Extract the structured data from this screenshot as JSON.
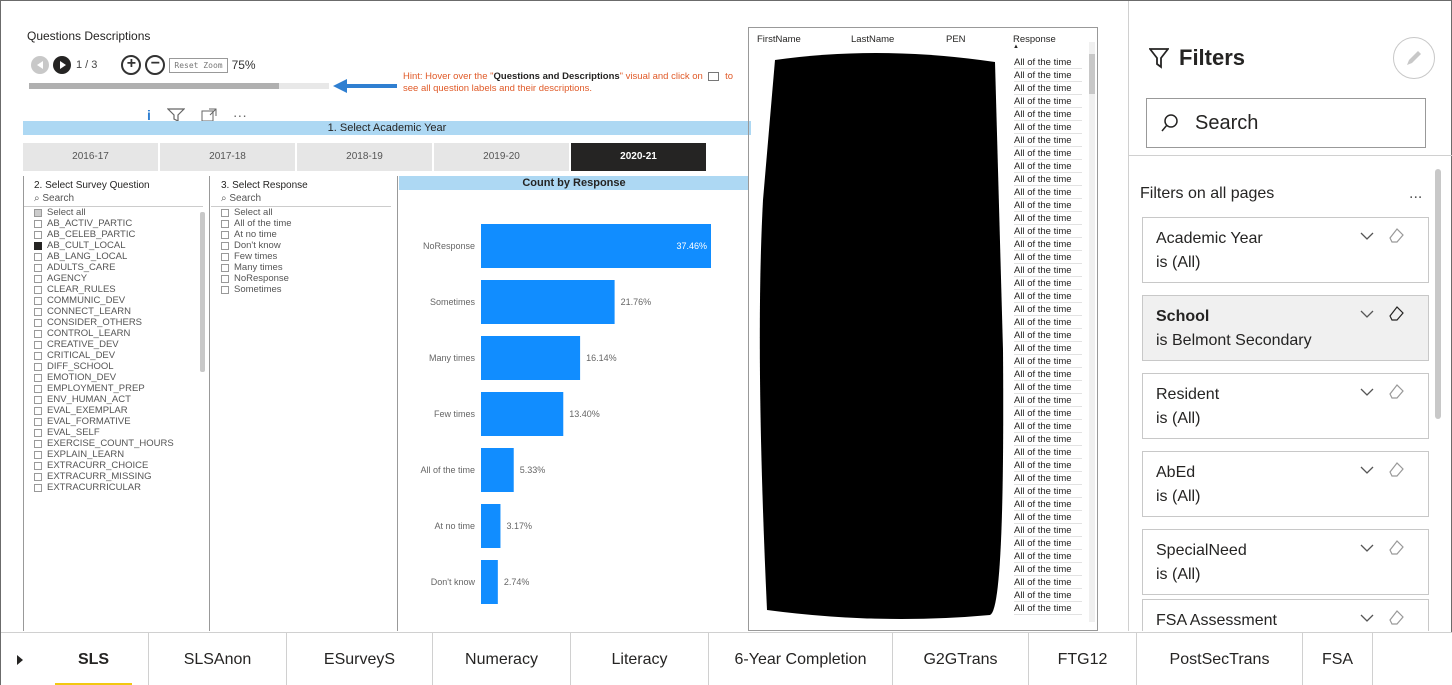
{
  "questions_descriptions": {
    "title": "Questions Descriptions",
    "page_indicator": "1 / 3",
    "reset_zoom_label": "Reset Zoom",
    "zoom_level": "75%",
    "hint_prefix": "Hint: Hover over the \"",
    "hint_bold": "Questions and Descriptions",
    "hint_suffix": "\" visual and click on",
    "hint_suffix2": "to see all question labels and their descriptions."
  },
  "academic_year": {
    "title": "1. Select Academic Year",
    "years": [
      "2016-17",
      "2017-18",
      "2018-19",
      "2019-20",
      "2020-21"
    ],
    "selected": "2020-21"
  },
  "survey_question": {
    "title": "2. Select Survey Question",
    "search_placeholder": "Search",
    "items": [
      "Select all",
      "AB_ACTIV_PARTIC",
      "AB_CELEB_PARTIC",
      "AB_CULT_LOCAL",
      "AB_LANG_LOCAL",
      "ADULTS_CARE",
      "AGENCY",
      "CLEAR_RULES",
      "COMMUNIC_DEV",
      "CONNECT_LEARN",
      "CONSIDER_OTHERS",
      "CONTROL_LEARN",
      "CREATIVE_DEV",
      "CRITICAL_DEV",
      "DIFF_SCHOOL",
      "EMOTION_DEV",
      "EMPLOYMENT_PREP",
      "ENV_HUMAN_ACT",
      "EVAL_EXEMPLAR",
      "EVAL_FORMATIVE",
      "EVAL_SELF",
      "EXERCISE_COUNT_HOURS",
      "EXPLAIN_LEARN",
      "EXTRACURR_CHOICE",
      "EXTRACURR_MISSING",
      "EXTRACURRICULAR"
    ],
    "checked": "AB_CULT_LOCAL"
  },
  "select_response": {
    "title": "3. Select Response",
    "search_placeholder": "Search",
    "items": [
      "Select all",
      "All of the time",
      "At no time",
      "Don't know",
      "Few times",
      "Many times",
      "NoResponse",
      "Sometimes"
    ]
  },
  "chart_data": {
    "type": "bar",
    "orientation": "horizontal",
    "title": "Count by Response",
    "categories": [
      "NoResponse",
      "Sometimes",
      "Many times",
      "Few times",
      "All of the time",
      "At no time",
      "Don't know"
    ],
    "values": [
      37.46,
      21.76,
      16.14,
      13.4,
      5.33,
      3.17,
      2.74
    ],
    "value_labels": [
      "37.46%",
      "21.76%",
      "16.14%",
      "13.40%",
      "5.33%",
      "3.17%",
      "2.74%"
    ],
    "bar_color": "#118dff"
  },
  "table": {
    "columns": [
      "FirstName",
      "LastName",
      "PEN",
      "Response"
    ],
    "response_values": [
      "All of the time",
      "All of the time",
      "All of the time",
      "All of the time",
      "All of the time",
      "All of the time",
      "All of the time",
      "All of the time",
      "All of the time",
      "All of the time",
      "All of the time",
      "All of the time",
      "All of the time",
      "All of the time",
      "All of the time",
      "All of the time",
      "All of the time",
      "All of the time",
      "All of the time",
      "All of the time",
      "All of the time",
      "All of the time",
      "All of the time",
      "All of the time",
      "All of the time",
      "All of the time",
      "All of the time",
      "All of the time",
      "All of the time",
      "All of the time",
      "All of the time",
      "All of the time",
      "All of the time",
      "All of the time",
      "All of the time",
      "All of the time",
      "All of the time",
      "All of the time",
      "All of the time",
      "All of the time",
      "All of the time",
      "All of the time",
      "All of the time"
    ]
  },
  "filters": {
    "title": "Filters",
    "search_placeholder": "Search",
    "section_title": "Filters on all pages",
    "more": "...",
    "cards": [
      {
        "name": "Academic Year",
        "value": "is (All)"
      },
      {
        "name": "School",
        "value": "is Belmont Secondary"
      },
      {
        "name": "Resident",
        "value": "is (All)"
      },
      {
        "name": "AbEd",
        "value": "is (All)"
      },
      {
        "name": "SpecialNeed",
        "value": "is (All)"
      },
      {
        "name": "FSA Assessment",
        "value": ""
      }
    ]
  },
  "tabs": [
    "SLS",
    "SLSAnon",
    "ESurveyS",
    "Numeracy",
    "Literacy",
    "6-Year Completion",
    "G2GTrans",
    "FTG12",
    "PostSecTrans",
    "FSA"
  ],
  "active_tab": "SLS"
}
